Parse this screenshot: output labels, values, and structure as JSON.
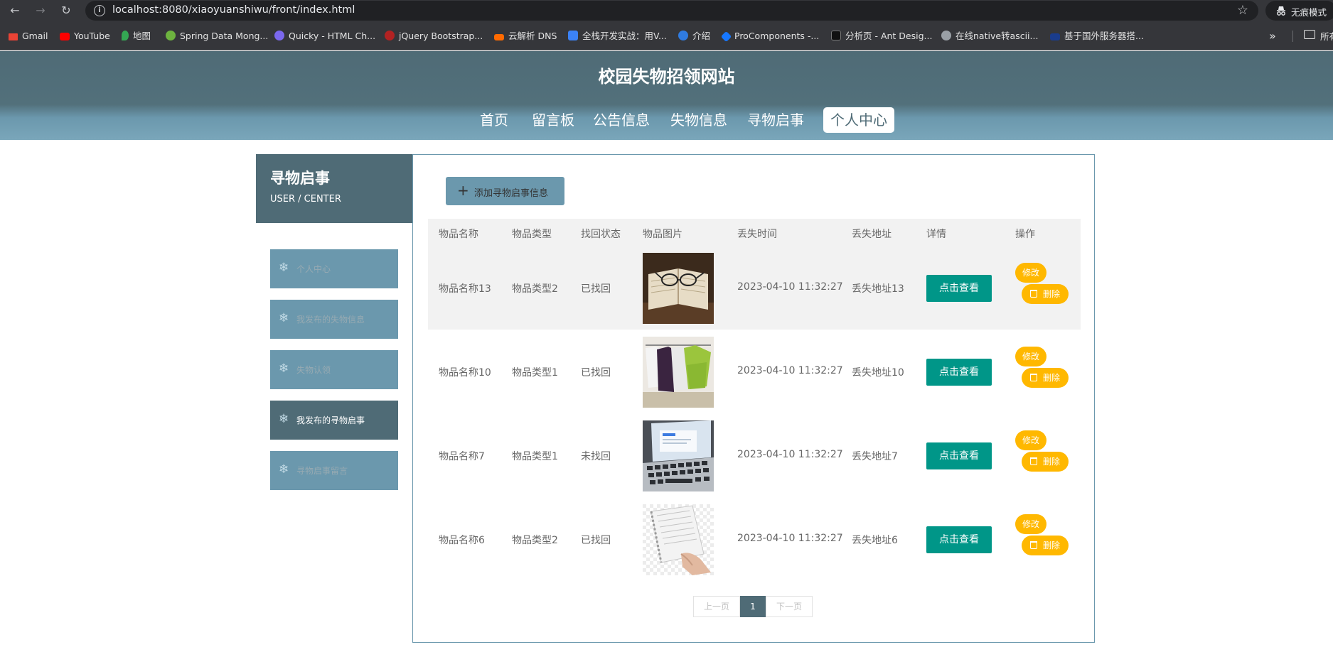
{
  "browser": {
    "url": "localhost:8080/xiaoyuanshiwu/front/index.html",
    "incognito_label": "无痕模式",
    "bookmarks": [
      {
        "label": "Gmail",
        "color": "#ea4335"
      },
      {
        "label": "YouTube",
        "color": "#ff0000"
      },
      {
        "label": "地图",
        "color": "#34a853"
      },
      {
        "label": "Spring Data Mong...",
        "color": "#6db33f"
      },
      {
        "label": "Quicky - HTML Ch...",
        "color": "#7b68ee"
      },
      {
        "label": "jQuery Bootstrap...",
        "color": "#b22222"
      },
      {
        "label": "云解析 DNS",
        "color": "#ff6a00"
      },
      {
        "label": "全栈开发实战：用V...",
        "color": "#3b82f6"
      },
      {
        "label": "介绍",
        "color": "#2f7be0"
      },
      {
        "label": "ProComponents -...",
        "color": "#1677ff"
      },
      {
        "label": "分析页 - Ant Desig...",
        "color": "#111111"
      },
      {
        "label": "在线native转ascii...",
        "color": "#9aa0a6"
      },
      {
        "label": "基于国外服务器搭...",
        "color": "#1a3c8c"
      }
    ],
    "all_bookmarks_label": "所有"
  },
  "site": {
    "title": "校园失物招领网站",
    "nav": [
      {
        "label": "首页",
        "active": false
      },
      {
        "label": "留言板",
        "active": false
      },
      {
        "label": "公告信息",
        "active": false
      },
      {
        "label": "失物信息",
        "active": false
      },
      {
        "label": "寻物启事",
        "active": false
      },
      {
        "label": "个人中心",
        "active": true
      }
    ],
    "accent_color": "#4f6b76"
  },
  "sidebar": {
    "title": "寻物启事",
    "subtitle": "USER / CENTER",
    "items": [
      {
        "label": "个人中心",
        "active": false
      },
      {
        "label": "我发布的失物信息",
        "active": false
      },
      {
        "label": "失物认领",
        "active": false
      },
      {
        "label": "我发布的寻物启事",
        "active": true
      },
      {
        "label": "寻物启事留言",
        "active": false
      }
    ]
  },
  "main": {
    "add_button_label": "添加寻物启事信息",
    "columns": [
      "物品名称",
      "物品类型",
      "找回状态",
      "物品图片",
      "丢失时间",
      "丢失地址",
      "详情",
      "操作"
    ],
    "rows": [
      {
        "name": "物品名称13",
        "type": "物品类型2",
        "status": "已找回",
        "image": "glasses-on-book",
        "time": "2023-04-10 11:32:27",
        "address": "丢失地址13"
      },
      {
        "name": "物品名称10",
        "type": "物品类型1",
        "status": "已找回",
        "image": "t-shirts-on-rack",
        "time": "2023-04-10 11:32:27",
        "address": "丢失地址10"
      },
      {
        "name": "物品名称7",
        "type": "物品类型1",
        "status": "未找回",
        "image": "laptop",
        "time": "2023-04-10 11:32:27",
        "address": "丢失地址7"
      },
      {
        "name": "物品名称6",
        "type": "物品类型2",
        "status": "已找回",
        "image": "notebook-in-hand",
        "time": "2023-04-10 11:32:27",
        "address": "丢失地址6"
      }
    ],
    "view_button_label": "点击查看",
    "edit_button_label": "修改",
    "delete_button_label": "删除",
    "pagination": {
      "prev": "上一页",
      "current": "1",
      "next": "下一页"
    }
  }
}
